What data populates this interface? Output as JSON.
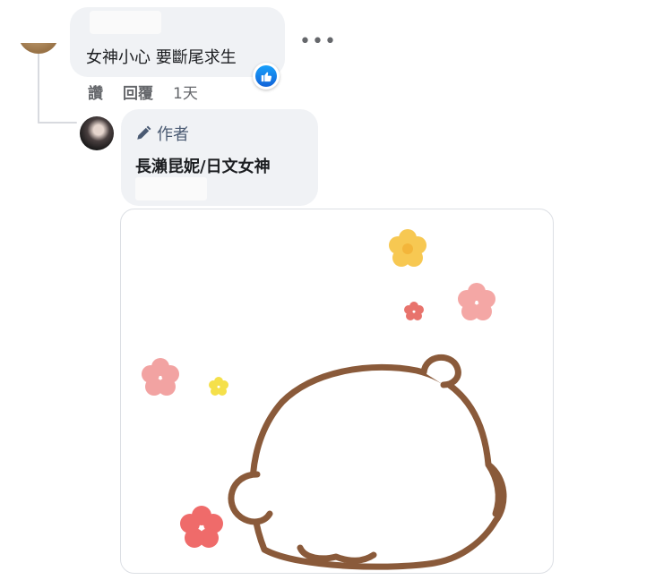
{
  "comment": {
    "text": "女神小心 要斷尾求生",
    "more_icon": "more-horiz-icon",
    "reaction_icon": "like-icon",
    "actions": {
      "like": "讚",
      "reply": "回覆",
      "time": "1天"
    }
  },
  "reply": {
    "author_badge_icon": "pencil-icon",
    "author_badge": "作者",
    "text": "長瀨昆妮/日文女神"
  },
  "sticker": {
    "icon": "bear-sticker"
  },
  "colors": {
    "bubble": "#f0f2f5",
    "secondary_text": "#65676b",
    "like_blue": "#1877f2"
  }
}
